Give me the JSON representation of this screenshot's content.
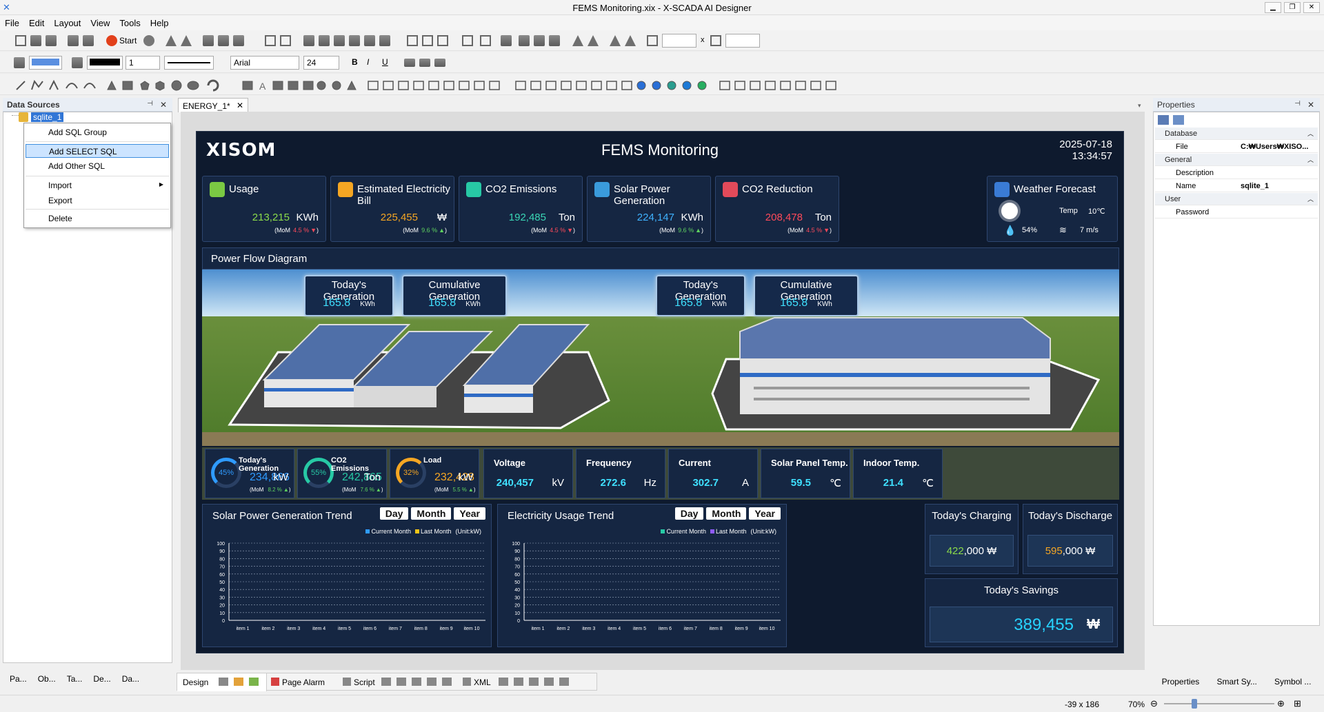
{
  "window": {
    "title": "FEMS Monitoring.xix - X-SCADA AI Designer"
  },
  "menu": [
    "File",
    "Edit",
    "Layout",
    "View",
    "Tools",
    "Help"
  ],
  "toolbar": {
    "start_label": "Start",
    "font_name": "Arial",
    "font_size": "24",
    "line_width": "1"
  },
  "data_sources": {
    "title": "Data Sources",
    "selected_node": "sqlite_1",
    "context_menu": [
      "Add SQL Group",
      "Add SELECT SQL",
      "Add Other SQL",
      "Import",
      "Export",
      "Delete"
    ],
    "bottom_tabs": [
      "Pa...",
      "Ob...",
      "Ta...",
      "De...",
      "Da..."
    ]
  },
  "doc_tab": "ENERGY_1*",
  "hmi": {
    "brand": "XISOM",
    "title": "FEMS Monitoring",
    "date": "2025-07-18",
    "time": "13:34:57",
    "cards": [
      {
        "label": "Usage",
        "value": "213,215",
        "unit": "KWh",
        "mom": "4.5 %",
        "dir": "down"
      },
      {
        "label": "Estimated Electricity Bill",
        "value": "225,455",
        "unit": "₩",
        "mom": "9.6 %",
        "dir": "up"
      },
      {
        "label": "CO2 Emissions",
        "value": "192,485",
        "unit": "Ton",
        "mom": "4.5 %",
        "dir": "down"
      },
      {
        "label": "Solar Power Generation",
        "value": "224,147",
        "unit": "KWh",
        "mom": "9.6 %",
        "dir": "up"
      },
      {
        "label": "CO2 Reduction",
        "value": "208,478",
        "unit": "Ton",
        "mom": "4.5 %",
        "dir": "down"
      }
    ],
    "mom_label": "(MoM",
    "weather": {
      "label": "Weather Forecast",
      "temp_label": "Temp",
      "temp": "10℃",
      "humidity": "54%",
      "wind": "7 m/s"
    },
    "power_flow_title": "Power Flow Diagram",
    "gen_boxes": [
      {
        "label": "Today's Generation",
        "value": "165.8",
        "unit": "KWh"
      },
      {
        "label": "Cumulative Generation",
        "value": "165.8",
        "unit": "KWh"
      },
      {
        "label": "Today's Generation",
        "value": "165.8",
        "unit": "KWh"
      },
      {
        "label": "Cumulative Generation",
        "value": "165.8",
        "unit": "KWh"
      }
    ],
    "gauges": [
      {
        "label": "Today's Generation",
        "pct": "45",
        "value": "234,866",
        "unit": "kW",
        "mom": "8.2 %",
        "color": "#2f9bff"
      },
      {
        "label": "CO2 Emissions",
        "pct": "55",
        "value": "242,865",
        "unit": "Ton",
        "mom": "7.6 %",
        "color": "#27c9a5"
      },
      {
        "label": "Load",
        "pct": "32",
        "value": "232,428",
        "unit": "kW",
        "mom": "5.5 %",
        "color": "#f5a623"
      }
    ],
    "stats": [
      {
        "label": "Voltage",
        "value": "240,457",
        "unit": "kV"
      },
      {
        "label": "Frequency",
        "value": "272.6",
        "unit": "Hz"
      },
      {
        "label": "Current",
        "value": "302.7",
        "unit": "A"
      },
      {
        "label": "Solar Panel Temp.",
        "value": "59.5",
        "unit": "℃"
      },
      {
        "label": "Indoor Temp.",
        "value": "21.4",
        "unit": "℃"
      }
    ],
    "trends": [
      {
        "title": "Solar Power Generation Trend",
        "legend_a": "Current Month",
        "legend_b": "Last Month",
        "legend_unit": "(Unit:kW)",
        "color_a": "#2f9bff",
        "color_b": "#f5c518"
      },
      {
        "title": "Electricity Usage Trend",
        "legend_a": "Current Month",
        "legend_b": "Last Month",
        "legend_unit": "(Unit:kW)",
        "color_a": "#27c9a5",
        "color_b": "#8f5bff"
      }
    ],
    "period_buttons": [
      "Day",
      "Month",
      "Year"
    ],
    "y_ticks": [
      "100",
      "90",
      "80",
      "70",
      "60",
      "50",
      "40",
      "30",
      "20",
      "10",
      "0"
    ],
    "x_ticks": [
      "item 1",
      "item 2",
      "item 3",
      "item 4",
      "item 5",
      "item 6",
      "item 7",
      "item 8",
      "item 9",
      "item 10"
    ],
    "charging": {
      "label": "Today's Charging",
      "value": "422",
      "rest": ",000 ₩"
    },
    "discharge": {
      "label": "Today's Discharge",
      "value": "595",
      "rest": ",000 ₩"
    },
    "savings": {
      "label": "Today's Savings",
      "value": "389,455",
      "unit": "₩"
    }
  },
  "bottom_doc_tabs": [
    "Design",
    "Page Alarm",
    "Script",
    "XML"
  ],
  "properties": {
    "title": "Properties",
    "rows": [
      {
        "cat": true,
        "k": "Database"
      },
      {
        "k": "File",
        "v": "C:₩Users₩XISO..."
      },
      {
        "cat": true,
        "k": "General"
      },
      {
        "k": "Description",
        "v": ""
      },
      {
        "k": "Name",
        "v": "sqlite_1"
      },
      {
        "cat": true,
        "k": "User"
      },
      {
        "k": "Password",
        "v": ""
      }
    ],
    "tabs": [
      "Properties",
      "Smart Sy...",
      "Symbol ..."
    ]
  },
  "status": {
    "coords": "-39 x 186",
    "zoom": "70%"
  }
}
